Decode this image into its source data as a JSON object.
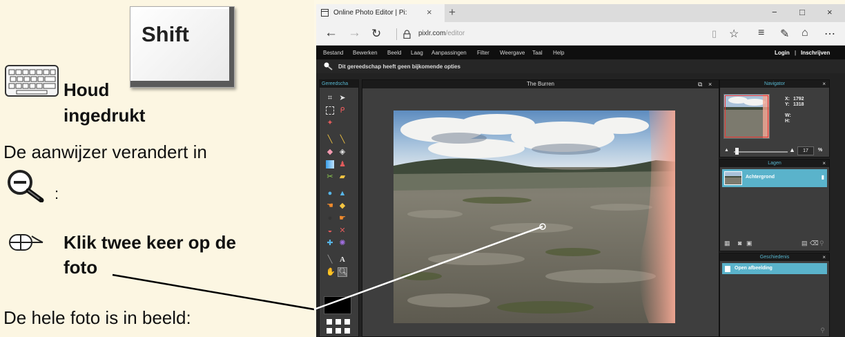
{
  "instructions": {
    "hold_label": "Houd",
    "hold_label_2": "ingedrukt",
    "shift_key": "Shift",
    "pointer_changes": "De aanwijzer verandert in",
    "colon": ":",
    "click_twice": "Klik twee keer op de",
    "click_twice_2": "foto",
    "result": "De hele foto is in beeld:"
  },
  "browser": {
    "tab_title": "Online Photo Editor | Pi:",
    "tab_close": "×",
    "new_tab": "+",
    "url_domain": "pixlr.com",
    "url_path": "/editor",
    "window_min": "−",
    "window_max": "□",
    "window_close": "×"
  },
  "app": {
    "menu": [
      "Bestand",
      "Bewerken",
      "Beeld",
      "Laag",
      "Aanpassingen",
      "Filter",
      "Weergave",
      "Taal",
      "Help"
    ],
    "login": "Login",
    "separator": "|",
    "register": "Inschrijven",
    "options_text": "Dit gereedschap heeft geen bijkomende opties",
    "tools_title": "Gereedscha",
    "document_title": "The Burren",
    "navigator": {
      "title": "Navigator",
      "x_label": "X:",
      "x_value": "1792",
      "y_label": "Y:",
      "y_value": "1318",
      "w_label": "W:",
      "h_label": "H:",
      "zoom_value": "17",
      "zoom_unit": "%"
    },
    "layers": {
      "title": "Lagen",
      "items": [
        {
          "name": "Achtergrond"
        }
      ]
    },
    "history": {
      "title": "Geschiedenis",
      "items": [
        {
          "name": "Open afbeelding"
        }
      ]
    },
    "close_glyph": "×",
    "colors": {
      "accent": "#5ab3cb",
      "menubar": "#0f0f0f",
      "panel": "#3d3d3d"
    }
  }
}
